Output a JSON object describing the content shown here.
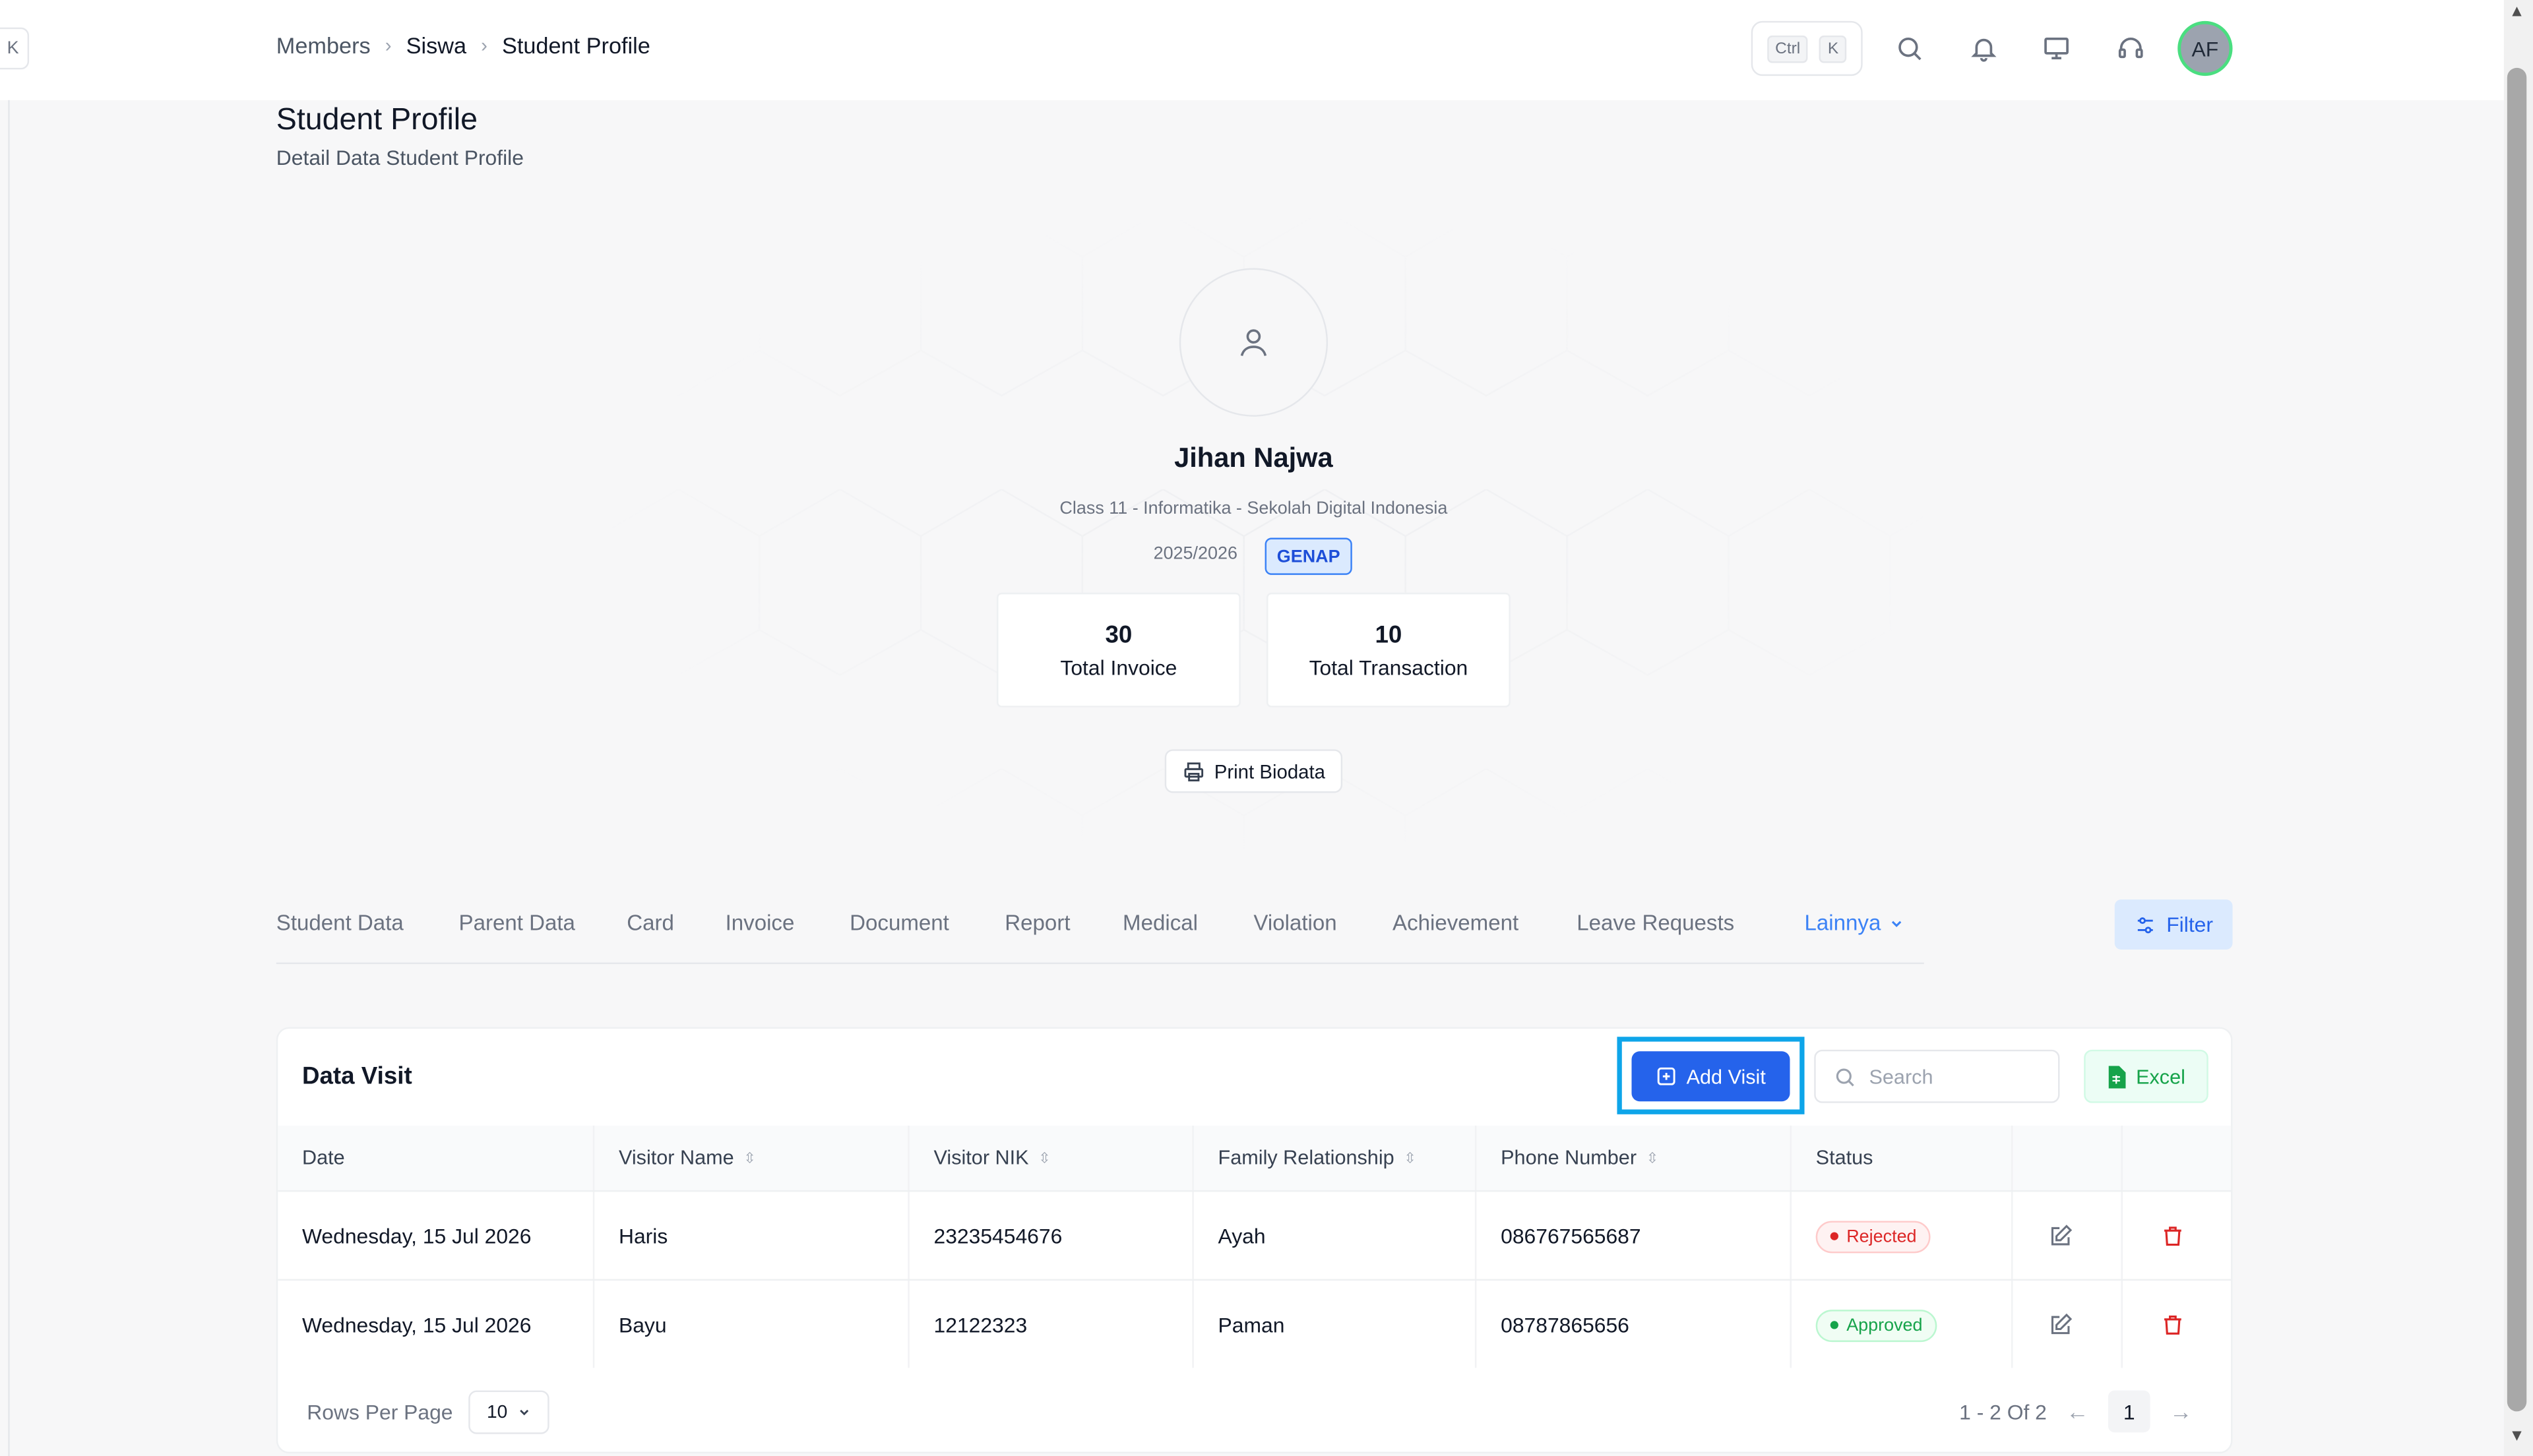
{
  "breadcrumb": [
    "Members",
    "Siswa",
    "Student Profile"
  ],
  "shortcut": {
    "key1": "Ctrl",
    "key2": "K"
  },
  "user": {
    "initials": "AF"
  },
  "page": {
    "title": "Student Profile",
    "subtitle": "Detail Data Student Profile"
  },
  "profile": {
    "name": "Jihan Najwa",
    "class_info": "Class 11 - Informatika - Sekolah Digital Indonesia",
    "year": "2025/2026",
    "semester_badge": "GENAP",
    "stats": [
      {
        "value": "30",
        "label": "Total Invoice"
      },
      {
        "value": "10",
        "label": "Total Transaction"
      }
    ],
    "print_label": "Print Biodata"
  },
  "tabs": [
    "Student Data",
    "Parent Data",
    "Card",
    "Invoice",
    "Document",
    "Report",
    "Medical",
    "Violation",
    "Achievement",
    "Leave Requests"
  ],
  "tabs_more": "Lainnya",
  "filter_label": "Filter",
  "visit_card": {
    "title": "Data Visit",
    "add_label": "Add Visit",
    "search_placeholder": "Search",
    "excel_label": "Excel",
    "columns": [
      "Date",
      "Visitor Name",
      "Visitor NIK",
      "Family Relationship",
      "Phone Number",
      "Status"
    ],
    "rows": [
      {
        "date": "Wednesday, 15 Jul 2026",
        "name": "Haris",
        "nik": "23235454676",
        "relationship": "Ayah",
        "phone": "086767565687",
        "status": "Rejected"
      },
      {
        "date": "Wednesday, 15 Jul 2026",
        "name": "Bayu",
        "nik": "12122323",
        "relationship": "Paman",
        "phone": "08787865656",
        "status": "Approved"
      }
    ],
    "rows_per_page_label": "Rows Per Page",
    "rows_per_page_value": "10",
    "pagination_summary": "1 - 2 Of 2",
    "current_page": "1"
  },
  "colors": {
    "primary": "#2563eb",
    "rejected": "#dc2626",
    "approved": "#16a34a",
    "highlight": "#0ea5e9"
  }
}
